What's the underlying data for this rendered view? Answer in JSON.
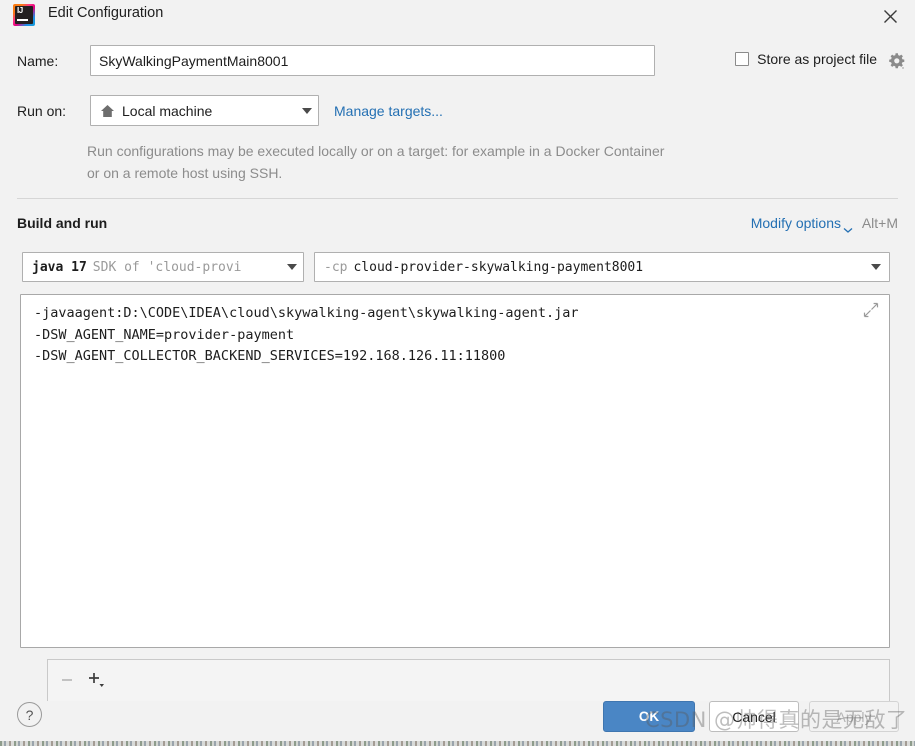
{
  "window": {
    "title": "Edit Configuration",
    "logo_icon": "intellij-idea-logo",
    "close_icon": "close-icon"
  },
  "name_row": {
    "label": "Name:",
    "value": "SkyWalkingPaymentMain8001",
    "placeholder": "Name"
  },
  "store_option": {
    "label": "Store as project file",
    "checked": false,
    "gear_icon": "gear-icon"
  },
  "run_on": {
    "label": "Run on:",
    "value": "Local machine",
    "icon": "home-icon",
    "manage_link": "Manage targets...",
    "description": "Run configurations may be executed locally or on a target: for example in a Docker Container or on a remote host using SSH."
  },
  "build_and_run": {
    "section_title": "Build and run",
    "modify_options": "Modify options",
    "modify_shortcut": "Alt+M",
    "chevron_icon": "chevron-down-icon",
    "jdk": {
      "main": "java 17",
      "sub": "SDK of 'cloud-provi",
      "caret_icon": "chevron-down-icon"
    },
    "classpath": {
      "flag": "-cp",
      "value": "cloud-provider-skywalking-payment8001",
      "caret_icon": "chevron-down-icon"
    },
    "vm_options": "-javaagent:D:\\CODE\\IDEA\\cloud\\skywalking-agent\\skywalking-agent.jar\n-DSW_AGENT_NAME=provider-payment\n-DSW_AGENT_COLLECTOR_BACKEND_SERVICES=192.168.126.11:11800",
    "expand_icon": "expand-collapse-icon"
  },
  "list_panel": {
    "remove_icon": "minus-icon",
    "add_icon": "plus-icon"
  },
  "footer": {
    "help_label": "?",
    "ok_label": "OK",
    "cancel_label": "Cancel",
    "apply_label": "Apply",
    "apply_enabled": false
  },
  "watermark": {
    "text": "CSDN @帅得真的是无敌了"
  },
  "colors": {
    "accent_blue": "#4a86c5",
    "link_blue": "#2470b3",
    "background": "#f2f2f2",
    "field_background": "#ffffff",
    "muted_text": "#8c8c8c"
  }
}
